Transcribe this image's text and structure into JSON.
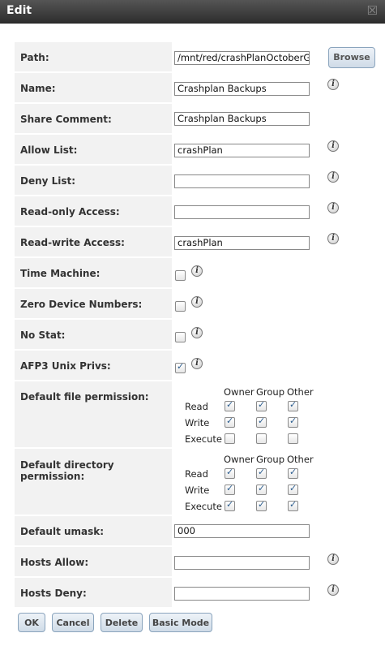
{
  "window": {
    "title": "Edit",
    "close_glyph": "☒"
  },
  "fields": {
    "path": {
      "label": "Path:",
      "value": "/mnt/red/crashPlanOctoberG",
      "browse_label": "Browse"
    },
    "name": {
      "label": "Name:",
      "value": "Crashplan Backups"
    },
    "share_comment": {
      "label": "Share Comment:",
      "value": "Crashplan Backups"
    },
    "allow_list": {
      "label": "Allow List:",
      "value": "crashPlan"
    },
    "deny_list": {
      "label": "Deny List:",
      "value": ""
    },
    "readonly_access": {
      "label": "Read-only Access:",
      "value": ""
    },
    "readwrite_access": {
      "label": "Read-write Access:",
      "value": "crashPlan"
    },
    "time_machine": {
      "label": "Time Machine:",
      "checked": false
    },
    "zero_device": {
      "label": "Zero Device Numbers:",
      "checked": false
    },
    "no_stat": {
      "label": "No Stat:",
      "checked": false
    },
    "afp3_unix": {
      "label": "AFP3 Unix Privs:",
      "checked": true
    },
    "default_umask": {
      "label": "Default umask:",
      "value": "000"
    },
    "hosts_allow": {
      "label": "Hosts Allow:",
      "value": ""
    },
    "hosts_deny": {
      "label": "Hosts Deny:",
      "value": ""
    }
  },
  "permissions": {
    "headers": [
      "Owner",
      "Group",
      "Other"
    ],
    "row_labels": [
      "Read",
      "Write",
      "Execute"
    ],
    "file": {
      "label": "Default file permission:",
      "grid": [
        [
          true,
          true,
          true
        ],
        [
          true,
          true,
          true
        ],
        [
          false,
          false,
          false
        ]
      ]
    },
    "directory": {
      "label": "Default directory permission:",
      "grid": [
        [
          true,
          true,
          true
        ],
        [
          true,
          true,
          true
        ],
        [
          true,
          true,
          true
        ]
      ]
    }
  },
  "help_icon_glyph": "i",
  "buttons": {
    "ok": "OK",
    "cancel": "Cancel",
    "delete": "Delete",
    "basic_mode": "Basic Mode"
  }
}
